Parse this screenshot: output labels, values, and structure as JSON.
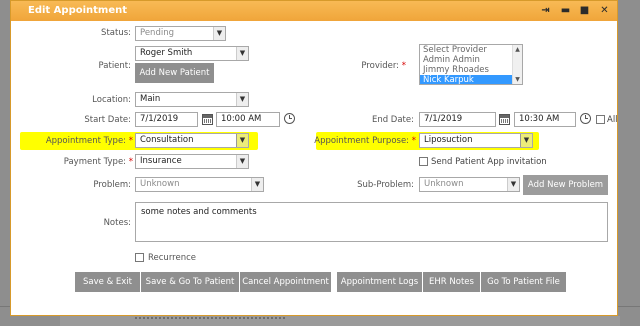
{
  "dialog": {
    "title": "Edit Appointment",
    "controls": {
      "pin": "⇥",
      "minimize": "▬",
      "maximize": "■",
      "close": "✕"
    }
  },
  "form": {
    "status": {
      "label": "Status:",
      "value": "Pending"
    },
    "patient": {
      "label": "Patient:",
      "value": "Roger  Smith",
      "add_button": "Add New Patient"
    },
    "provider": {
      "label": "Provider:",
      "options": [
        "Select Provider",
        "Admin Admin",
        "Jimmy Rhoades",
        "Nick Karpuk"
      ],
      "selected": "Nick Karpuk"
    },
    "location": {
      "label": "Location:",
      "value": "Main"
    },
    "start": {
      "label": "Start Date:",
      "date": "7/1/2019",
      "time": "10:00 AM"
    },
    "end": {
      "label": "End Date:",
      "date": "7/1/2019",
      "time": "10:30 AM"
    },
    "all_day": {
      "label": "All Day",
      "checked": false
    },
    "appointment_type": {
      "label": "Appointment Type:",
      "value": "Consultation"
    },
    "appointment_purpose": {
      "label": "Appointment Purpose:",
      "value": "Liposuction"
    },
    "payment_type": {
      "label": "Payment Type:",
      "value": "Insurance"
    },
    "send_invitation": {
      "label": "Send Patient App invitation",
      "checked": false
    },
    "problem": {
      "label": "Problem:",
      "value": "Unknown"
    },
    "sub_problem": {
      "label": "Sub-Problem:",
      "value": "Unknown",
      "add_button": "Add New Problem"
    },
    "notes": {
      "label": "Notes:",
      "value": "some notes and comments"
    },
    "recurrence": {
      "label": "Recurrence",
      "checked": false
    }
  },
  "buttons": {
    "save_exit": "Save & Exit",
    "save_go_patient": "Save & Go To Patient",
    "cancel_appointment": "Cancel Appointment",
    "appointment_logs": "Appointment Logs",
    "ehr_notes": "EHR Notes",
    "go_to_patient_file": "Go To Patient File"
  },
  "colors": {
    "title_bar": "#f0a53a",
    "highlight": "#ffff00",
    "required": "#d60000",
    "button": "#8f8f8f",
    "list_selected": "#3399ff"
  },
  "required_marker": "*"
}
